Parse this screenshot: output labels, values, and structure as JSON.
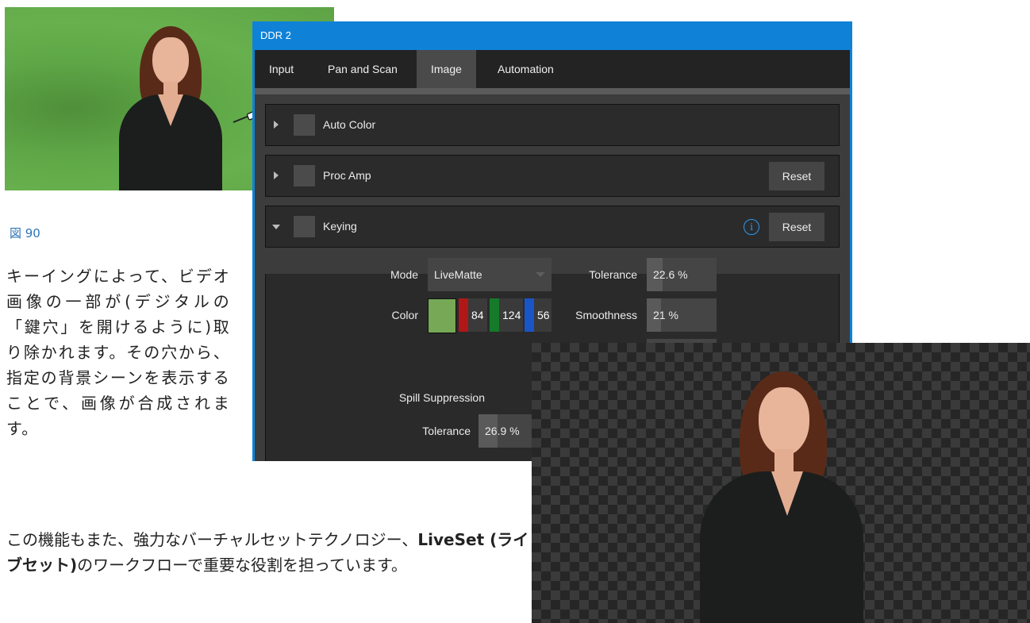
{
  "figure": {
    "caption": "図 90"
  },
  "text": {
    "para1": "キーイングによって、ビデオ画像の一部が(デジタルの「鍵穴」を開けるように)取り除かれます。その穴から、指定の背景シーンを表示することで、画像が合成されます。",
    "para2_prefix": "この機能もまた、強力なバーチャルセットテクノロジー、",
    "para2_bold": "LiveSet (ライブセット)",
    "para2_suffix": "のワークフローで重要な役割を担っています。"
  },
  "panel": {
    "title": "DDR 2",
    "tabs": [
      {
        "label": "Input"
      },
      {
        "label": "Pan and Scan"
      },
      {
        "label": "Image"
      },
      {
        "label": "Automation"
      }
    ],
    "active_tab": "Image",
    "sections": {
      "auto_color": {
        "label": "Auto Color"
      },
      "proc_amp": {
        "label": "Proc Amp",
        "reset": "Reset"
      },
      "keying": {
        "label": "Keying",
        "reset": "Reset",
        "info": "i"
      }
    },
    "keying": {
      "mode_label": "Mode",
      "mode_value": "LiveMatte",
      "tolerance_label": "Tolerance",
      "tolerance_value": "22.6 %",
      "tolerance_fraction": 0.226,
      "color_label": "Color",
      "color_swatch": "#76a856",
      "color_r": "84",
      "color_g": "124",
      "color_b": "56",
      "smoothness_label": "Smoothness",
      "smoothness_value": "21 %",
      "smoothness_fraction": 0.21,
      "spill_label": "Spill Suppression",
      "spill_tolerance_label": "Tolerance",
      "spill_tolerance_value": "26.9 %",
      "spill_tolerance_fraction": 0.269
    }
  },
  "colors": {
    "panel_border": "#0f82d8",
    "caption": "#2e75b6",
    "info": "#2b9af3",
    "red_channel": "#b01818",
    "green_channel": "#157a2a",
    "blue_channel": "#1a55c8"
  }
}
